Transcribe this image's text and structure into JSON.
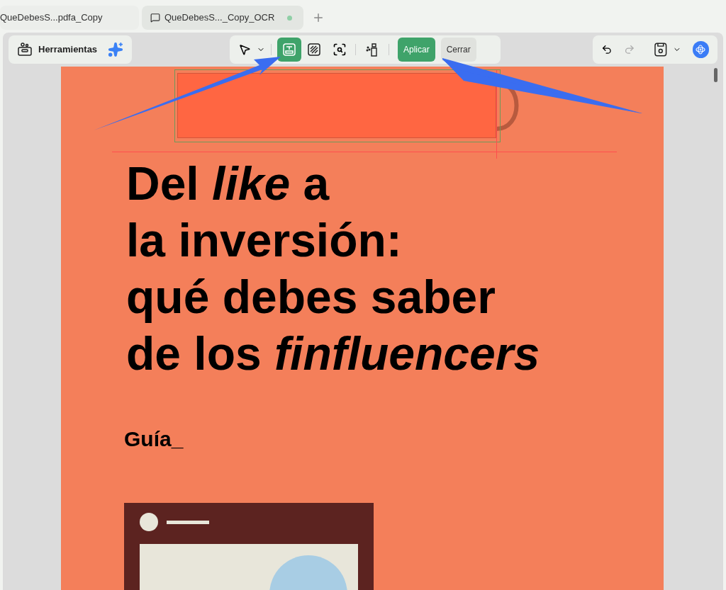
{
  "tabs": [
    {
      "label": "QueDebesS...pdfa_Copy",
      "selected": false,
      "modified": false
    },
    {
      "label": "QueDebesS..._Copy_OCR",
      "selected": true,
      "modified": true
    }
  ],
  "toolbar": {
    "tools_label": "Herramientas",
    "redact_tool_selected": true,
    "apply_button": "Aplicar",
    "close_button": "Cerrar"
  },
  "document": {
    "title_lines": [
      "Del *like* a",
      "la inversión:",
      "qué debes saber",
      "de los *finfluencers*"
    ],
    "subtitle": "Guía_"
  }
}
